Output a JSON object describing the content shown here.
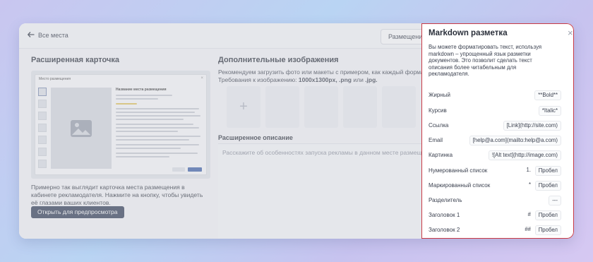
{
  "topbar": {
    "back_label": "Все места",
    "right_button": "Размещение"
  },
  "card_section": {
    "title": "Расширенная карточка",
    "preview": {
      "modal_title": "Место размещения",
      "heading": "Название места размещения"
    },
    "caption": "Примерно так выглядит карточка места размещения в кабинете рекламодателя. Нажмите на кнопку, чтобы увидеть её глазами ваших клиентов.",
    "button": "Открыть для предпросмотра"
  },
  "images_section": {
    "title": "Дополнительные изображения",
    "line1": "Рекомендуем загрузить фото или макеты с примером, как каждый формат ре",
    "line2_prefix": "Требования к изображению: ",
    "line2_bold": "1000х1300px, .png",
    "line2_mid": " или ",
    "line2_end": ".jpg.",
    "add_symbol": "+"
  },
  "description_section": {
    "title": "Расширенное описание",
    "placeholder": "Расскажите об особенностях запуска рекламы в данном месте размещения"
  },
  "panel": {
    "title": "Markdown разметка",
    "close_symbol": "×",
    "description": "Вы можете форматировать текст, используя markdown – упрощенный язык разметки документов. Это позволит сделать текст описания более читабельным для рекламодателя.",
    "rows": [
      {
        "label": "Жирный",
        "chips": [
          "**Bold**"
        ]
      },
      {
        "label": "Курсив",
        "chips": [
          "*Italic*"
        ]
      },
      {
        "label": "Ссылка",
        "chips": [
          "[Link](http://site.com)"
        ]
      },
      {
        "label": "Email",
        "chips": [
          "[help@a.com](mailto:help@a.com)"
        ]
      },
      {
        "label": "Картинка",
        "chips": [
          "![Alt text](http://image.com)"
        ]
      },
      {
        "label": "Нумерованный список",
        "chips": [
          "1.",
          "Пробел"
        ]
      },
      {
        "label": "Маркированный список",
        "chips": [
          "*",
          "Пробел"
        ]
      },
      {
        "label": "Разделитель",
        "chips": [
          "---"
        ]
      },
      {
        "label": "Заголовок 1",
        "chips": [
          "#",
          "Пробел"
        ]
      },
      {
        "label": "Заголовок 2",
        "chips": [
          "##",
          "Пробел"
        ]
      }
    ]
  }
}
